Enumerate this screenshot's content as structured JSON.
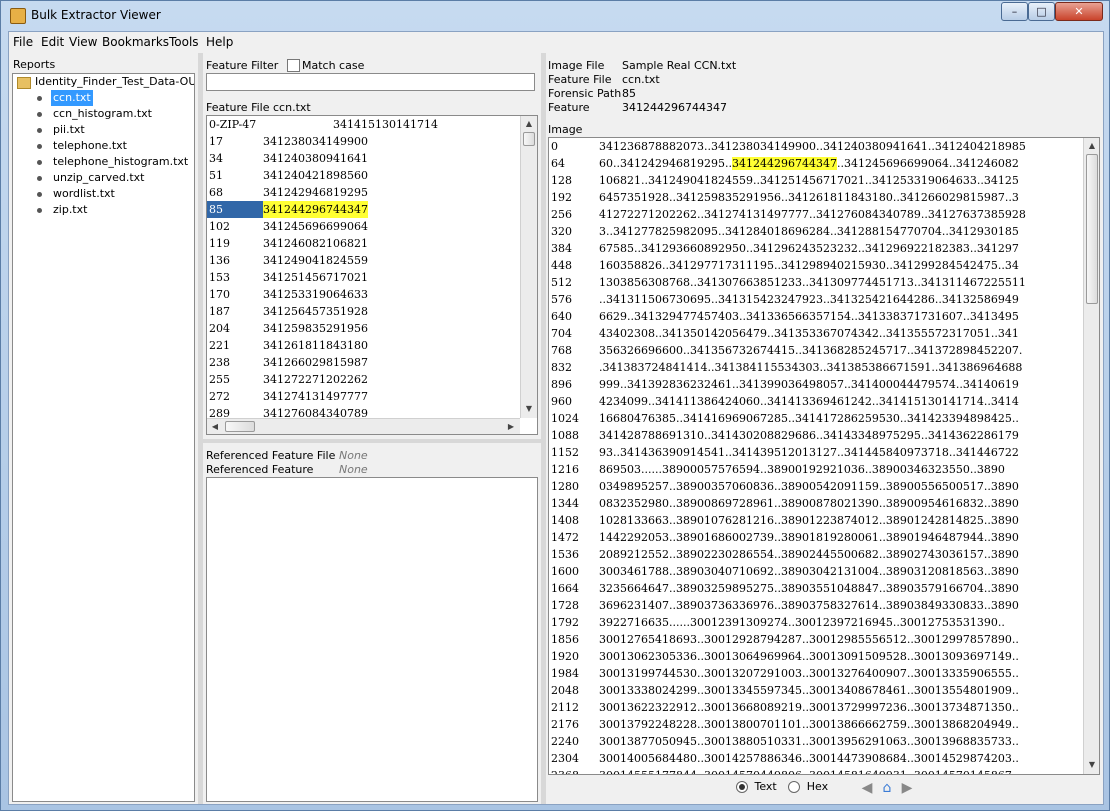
{
  "window": {
    "title": "Bulk Extractor Viewer",
    "controls": {
      "minimize": "–",
      "maximize": "□",
      "close": "✕"
    }
  },
  "menu": [
    "File",
    "Edit",
    "View",
    "Bookmarks",
    "Tools",
    "Help"
  ],
  "reports": {
    "header": "Reports",
    "root": "Identity_Finder_Test_Data-OUTP",
    "files": [
      "ccn.txt",
      "ccn_histogram.txt",
      "pii.txt",
      "telephone.txt",
      "telephone_histogram.txt",
      "unzip_carved.txt",
      "wordlist.txt",
      "zip.txt"
    ],
    "selected_index": 0
  },
  "feature_panel": {
    "filter_label": "Feature Filter",
    "match_case_label": "Match case",
    "filter_value": "",
    "feature_file_label": "Feature File",
    "feature_file_value": "ccn.txt",
    "rows": [
      [
        "0-ZIP-47",
        "341415130141714"
      ],
      [
        "17",
        "341238034149900"
      ],
      [
        "34",
        "341240380941641"
      ],
      [
        "51",
        "341240421898560"
      ],
      [
        "68",
        "341242946819295"
      ],
      [
        "85",
        "341244296744347"
      ],
      [
        "102",
        "341245696699064"
      ],
      [
        "119",
        "341246082106821"
      ],
      [
        "136",
        "341249041824559"
      ],
      [
        "153",
        "341251456717021"
      ],
      [
        "170",
        "341253319064633"
      ],
      [
        "187",
        "341256457351928"
      ],
      [
        "204",
        "341259835291956"
      ],
      [
        "221",
        "341261811843180"
      ],
      [
        "238",
        "341266029815987"
      ],
      [
        "255",
        "341272271202262"
      ],
      [
        "272",
        "341274131497777"
      ],
      [
        "289",
        "341276084340789"
      ]
    ],
    "selected_row": 5,
    "referenced_file_label": "Referenced Feature File",
    "referenced_file_value": "None",
    "referenced_feature_label": "Referenced Feature",
    "referenced_feature_value": "None"
  },
  "image_panel": {
    "image_file_label": "Image File",
    "image_file_value": "Sample Real CCN.txt",
    "feature_file_label": "Feature File",
    "feature_file_value": "ccn.txt",
    "forensic_path_label": "Forensic Path",
    "forensic_path_value": "85",
    "feature_label": "Feature",
    "feature_value": "341244296744347",
    "image_label": "Image",
    "highlight": {
      "row": 1,
      "before": "60..341242946819295..",
      "match": "341244296744347",
      "after": "..341245696699064..341246082"
    },
    "rows": [
      [
        "0",
        "341236878882073..341238034149900..341240380941641..341240421898​5"
      ],
      [
        "64",
        ""
      ],
      [
        "128",
        "106821..341249041824559..341251456717021..341253319064633..3412​5"
      ],
      [
        "192",
        "6457351928..341259835291956..341261811843180..341266029815987..3"
      ],
      [
        "256",
        "41272271202262..341274131497777..341276084340789..341276373859​28"
      ],
      [
        "320",
        "3..341277825982095..341284018696284..341288154770704..341293018​5"
      ],
      [
        "384",
        "67585..341293660892950..341296243523232..341296922182383..341297"
      ],
      [
        "448",
        "160358826..341297717311195..341298940215930..341299284542475..34"
      ],
      [
        "512",
        "1303856308768..341307663851233..341309774451713..341311467225511"
      ],
      [
        "576",
        "..341311506730695..341315423247923..341325421644286..341325869​49"
      ],
      [
        "640",
        "6629..341329477457403..341336566357154..341338371731607..341349​5"
      ],
      [
        "704",
        "43402308..341350142056479..341353367074342..341355572317051..341"
      ],
      [
        "768",
        "356326696600..341356732674415..341368285245717..341372898452207."
      ],
      [
        "832",
        ".341383724841414..341384115534303..341385386671591..341386964688"
      ],
      [
        "896",
        "999..341392836232461..341399036498057..341400044479574..34140619"
      ],
      [
        "960",
        "4234099..341411386424060..341413369461242..341415130141714..3414"
      ],
      [
        "1024",
        "16680476385..341416969067285..341417286259530..341423394898425.."
      ],
      [
        "1088",
        "341428788691310..341430208829686..341433489752​95..34143622861​79"
      ],
      [
        "1152",
        "93..341436390914541..341439512013127..341445840973718..34144672​2"
      ],
      [
        "1216",
        "869503......38900057576594..38900192921036..38900346323550..3890"
      ],
      [
        "1280",
        "0349895257..38900357060836..38900542091159..38900556500517..3890"
      ],
      [
        "1344",
        "0832352980..38900869728961..38900878021390..38900954616832..3890"
      ],
      [
        "1408",
        "1028133663..38901076281216..38901223874012..38901242814825..3890"
      ],
      [
        "1472",
        "1442292053..38901686002739..38901819280061..38901946487944..3890"
      ],
      [
        "1536",
        "2089212552..38902230286554..38902445500682..38902743036157..3890"
      ],
      [
        "1600",
        "3003461788..38903040710692..38903042131004..38903120818563..3890"
      ],
      [
        "1664",
        "3235664647..38903259895275..38903551048847..38903579166704..3890"
      ],
      [
        "1728",
        "3696231407..38903736336976..38903758327614..38903849330833..3890"
      ],
      [
        "1792",
        "3922716635......30012391309274..30012397216945..300127535313​90.."
      ],
      [
        "1856",
        "30012765418693..30012928794287..30012985556512..30012997857890.."
      ],
      [
        "1920",
        "30013062305336..30013064969964..30013091509528..30013093697149.."
      ],
      [
        "1984",
        "30013199744530..30013207291003..30013276400907..30013335906555.."
      ],
      [
        "2048",
        "30013338024299..30013345597345..30013408678461..30013554801909.."
      ],
      [
        "2112",
        "30013622322912..30013668089219..30013729997236..30013734871350.."
      ],
      [
        "2176",
        "30013792248228..30013800701101..30013866662759..30013868204949.."
      ],
      [
        "2240",
        "30013877050945..30013880510331..30013956291063..30013968835733.."
      ],
      [
        "2304",
        "30014005684480..30014257886346..30014473908684..30014529874203.."
      ],
      [
        "2368",
        "30014555177844..30014570449806..30014581649931..30014570145867.."
      ]
    ],
    "view_text_label": "Text",
    "view_hex_label": "Hex",
    "view_mode": "Text"
  }
}
